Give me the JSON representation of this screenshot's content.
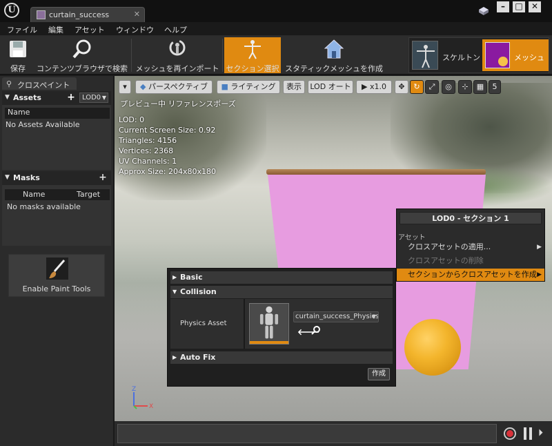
{
  "window": {
    "tab_title": "curtain_success",
    "tab_close": "✕",
    "min": "–",
    "max": "□",
    "close": "✕"
  },
  "menu": [
    "ファイル",
    "編集",
    "アセット",
    "ウィンドウ",
    "ヘルプ"
  ],
  "toolbar": {
    "save": "保存",
    "content_browser": "コンテンツブラウザで検索",
    "reimport": "メッシュを再インポート",
    "section_select": "セクション選択",
    "make_static": "スタティックメッシュを作成",
    "skeleton": "スケルトン",
    "mesh": "メッシュ"
  },
  "left_panel": {
    "tab_label": "クロスペイント",
    "assets_header": "Assets",
    "lod_selector": "LOD0",
    "assets_column": "Name",
    "assets_empty": "No Assets Available",
    "masks_header": "Masks",
    "masks_columns": [
      "Name",
      "Target"
    ],
    "masks_empty": "No masks available",
    "paint_button": "Enable Paint Tools"
  },
  "viewport": {
    "toolbar": {
      "perspective": "パースペクティブ",
      "lighting": "ライティング",
      "show": "表示",
      "lod": "LOD オート",
      "speed": "x1.0",
      "grid_num": "5"
    },
    "mode_label": "プレビュー中 リファレンスポーズ",
    "stats": [
      "LOD: 0",
      "Current Screen Size: 0.92",
      "Triangles: 4156",
      "Vertices: 2368",
      "UV Channels: 1",
      "Approx Size: 204x80x180"
    ],
    "axis": {
      "z": "Z",
      "x": "X"
    }
  },
  "context_menu": {
    "title": "LOD0 - セクション 1",
    "section": "アセット",
    "items": [
      {
        "label": "クロスアセットの適用...",
        "state": "normal",
        "arrow": "▶"
      },
      {
        "label": "クロスアセットの削除",
        "state": "disabled",
        "arrow": ""
      },
      {
        "label": "セクションからクロスアセットを作成",
        "state": "highlighted",
        "arrow": "▶"
      }
    ]
  },
  "properties": {
    "basic": "Basic",
    "collision": "Collision",
    "physics_asset_label": "Physics Asset",
    "physics_asset_value": "curtain_success_PhysicsAsset",
    "auto_fix": "Auto Fix",
    "create_button": "作成"
  },
  "colors": {
    "accent": "#e08a11",
    "curtain": "#e79ce0",
    "sphere": "#f3b52c"
  }
}
